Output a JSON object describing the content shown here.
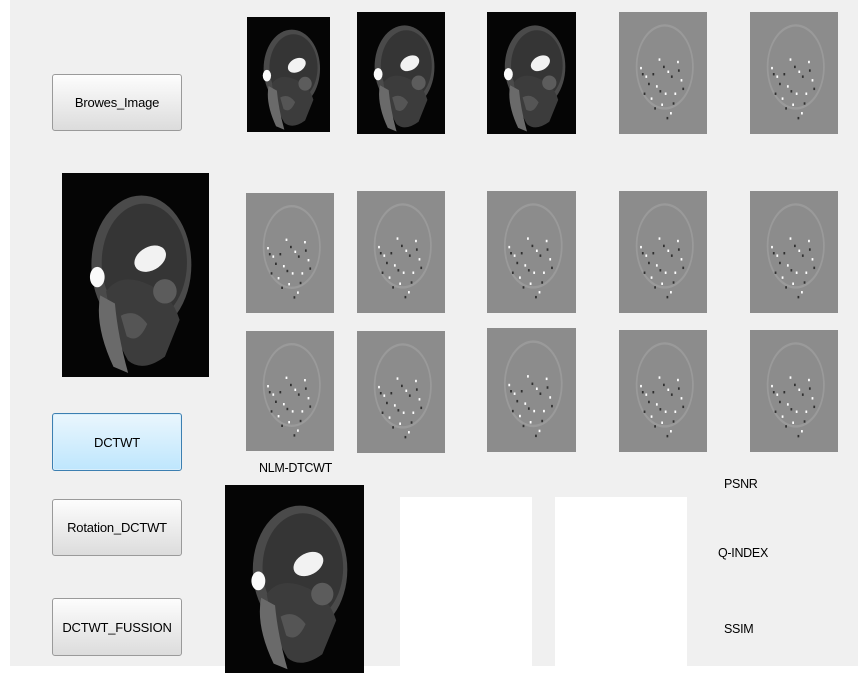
{
  "buttons": {
    "browse": "Browes_Image",
    "dctwt": "DCTWT",
    "rotation": "Rotation_DCTWT",
    "fusion": "DCTWT_FUSSION"
  },
  "labels": {
    "nlm_dtcwt": "NLM-DTCWT",
    "psnr": "PSNR",
    "qindex": "Q-INDEX",
    "ssim": "SSIM"
  },
  "colors": {
    "panel_background": "#f0f0f0",
    "active_button": "#bee6fd",
    "subband_gray": "#8c8c8c"
  }
}
